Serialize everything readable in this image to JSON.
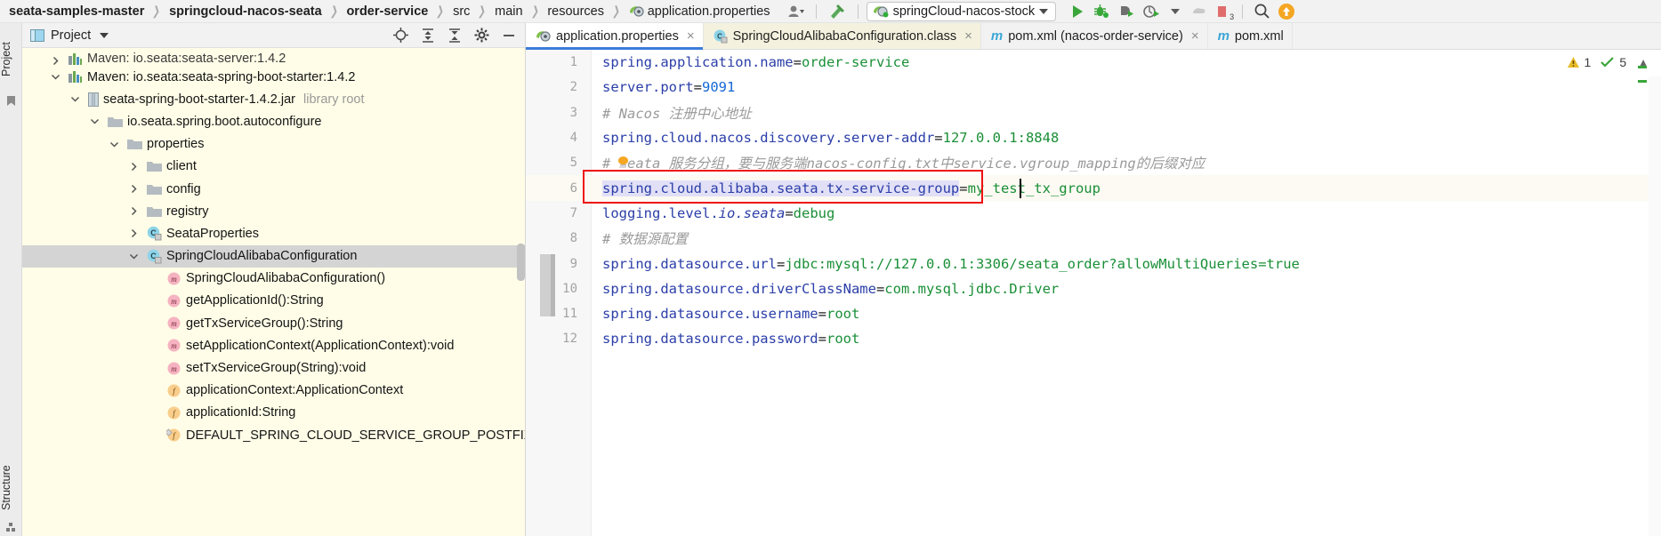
{
  "topbar": {
    "breadcrumbs": [
      {
        "label": "seata-samples-master",
        "bold": true,
        "icon": ""
      },
      {
        "label": "springcloud-nacos-seata",
        "bold": true,
        "icon": ""
      },
      {
        "label": "order-service",
        "bold": true,
        "icon": ""
      },
      {
        "label": "src",
        "bold": false,
        "icon": ""
      },
      {
        "label": "main",
        "bold": false,
        "icon": ""
      },
      {
        "label": "resources",
        "bold": false,
        "icon": ""
      },
      {
        "label": "application.properties",
        "bold": false,
        "icon": "spring-properties-icon"
      }
    ],
    "separator": "›",
    "user_icon": "user-avatar-icon",
    "hammer_icon": "build-hammer-icon",
    "run_config": {
      "label": "springCloud-nacos-stock",
      "icon": "spring-boot-run-icon",
      "caret": "chevron-down-icon"
    },
    "actions": [
      {
        "name": "run-button",
        "icon": "play-icon"
      },
      {
        "name": "debug-button",
        "icon": "bug-icon"
      },
      {
        "name": "run-with-coverage-button",
        "icon": "coverage-icon"
      },
      {
        "name": "profile-button",
        "icon": "profiler-icon"
      },
      {
        "name": "stop-button",
        "icon": "stop-icon"
      },
      {
        "name": "services-badge",
        "icon": "services-icon",
        "badge": "3"
      },
      {
        "name": "search-everywhere-button",
        "icon": "search-icon"
      },
      {
        "name": "updates-button",
        "icon": "update-arrow-icon"
      }
    ]
  },
  "left_strip": {
    "project_label": "Project",
    "structure_label": "Structure"
  },
  "project_panel": {
    "title": "Project",
    "title_icon": "project-window-icon",
    "caret_icon": "chevron-down-icon",
    "header_actions": [
      {
        "name": "locate-file-button",
        "icon": "crosshair-icon"
      },
      {
        "name": "expand-all-button",
        "icon": "expand-all-icon"
      },
      {
        "name": "collapse-all-button",
        "icon": "collapse-all-icon"
      },
      {
        "name": "settings-button",
        "icon": "gear-icon"
      },
      {
        "name": "hide-button",
        "icon": "minus-icon"
      }
    ],
    "tree": [
      {
        "indent": 1,
        "arrow": "›",
        "icon": "maven-icon",
        "label": "Maven: io.seata:seata-server:1.4.2",
        "dim": "",
        "selected": false,
        "clipped": true
      },
      {
        "indent": 1,
        "arrow": "∨",
        "icon": "maven-icon",
        "label": "Maven: io.seata:seata-spring-boot-starter:1.4.2",
        "dim": "",
        "selected": false
      },
      {
        "indent": 2,
        "arrow": "∨",
        "icon": "jar-icon",
        "label": "seata-spring-boot-starter-1.4.2.jar",
        "dim": "library root",
        "selected": false
      },
      {
        "indent": 3,
        "arrow": "∨",
        "icon": "folder-icon",
        "label": "io.seata.spring.boot.autoconfigure",
        "dim": "",
        "selected": false
      },
      {
        "indent": 4,
        "arrow": "∨",
        "icon": "folder-icon",
        "label": "properties",
        "dim": "",
        "selected": false
      },
      {
        "indent": 5,
        "arrow": "›",
        "icon": "folder-icon",
        "label": "client",
        "dim": "",
        "selected": false
      },
      {
        "indent": 5,
        "arrow": "›",
        "icon": "folder-icon",
        "label": "config",
        "dim": "",
        "selected": false
      },
      {
        "indent": 5,
        "arrow": "›",
        "icon": "folder-icon",
        "label": "registry",
        "dim": "",
        "selected": false
      },
      {
        "indent": 5,
        "arrow": "›",
        "icon": "class-icon",
        "label": "SeataProperties",
        "dim": "",
        "selected": false
      },
      {
        "indent": 5,
        "arrow": "∨",
        "icon": "class-icon",
        "label": "SpringCloudAlibabaConfiguration",
        "dim": "",
        "selected": true
      },
      {
        "indent": 6,
        "arrow": "",
        "icon": "method-icon",
        "label": "SpringCloudAlibabaConfiguration()",
        "dim": "",
        "selected": false
      },
      {
        "indent": 6,
        "arrow": "",
        "icon": "method-icon",
        "label": "getApplicationId():String",
        "dim": "",
        "selected": false
      },
      {
        "indent": 6,
        "arrow": "",
        "icon": "method-icon",
        "label": "getTxServiceGroup():String",
        "dim": "",
        "selected": false
      },
      {
        "indent": 6,
        "arrow": "",
        "icon": "method-icon",
        "label": "setApplicationContext(ApplicationContext):void",
        "dim": "",
        "selected": false
      },
      {
        "indent": 6,
        "arrow": "",
        "icon": "method-icon",
        "label": "setTxServiceGroup(String):void",
        "dim": "",
        "selected": false
      },
      {
        "indent": 6,
        "arrow": "",
        "icon": "field-icon",
        "label": "applicationContext:ApplicationContext",
        "dim": "",
        "selected": false
      },
      {
        "indent": 6,
        "arrow": "",
        "icon": "field-icon",
        "label": "applicationId:String",
        "dim": "",
        "selected": false
      },
      {
        "indent": 6,
        "arrow": "",
        "icon": "static-field-icon",
        "label": "DEFAULT_SPRING_CLOUD_SERVICE_GROUP_POSTFIX:S",
        "dim": "",
        "selected": false
      }
    ]
  },
  "editor": {
    "tabs": [
      {
        "label": "application.properties",
        "icon": "spring-properties-icon",
        "active": true,
        "close": "×"
      },
      {
        "label": "SpringCloudAlibabaConfiguration.class",
        "icon": "class-icon",
        "active": false,
        "close": "×"
      },
      {
        "label": "pom.xml (nacos-order-service)",
        "icon": "maven-m-icon",
        "active": false,
        "close": "×"
      },
      {
        "label": "pom.xml",
        "icon": "maven-m-icon",
        "active": false,
        "close": ""
      }
    ],
    "inspection": {
      "warning_count": "1",
      "warning_icon": "warning-triangle-icon",
      "ok_count": "5",
      "ok_icon": "inspection-check-icon",
      "collapse_icon": "chevron-up-icon"
    },
    "cursor_line": 6,
    "file_name": "application.properties",
    "lines": [
      {
        "num": "1",
        "segments": [
          {
            "t": "spring.application.name",
            "c": "k-key"
          },
          {
            "t": "=",
            "c": "k-eq"
          },
          {
            "t": "order-service",
            "c": "k-val"
          }
        ]
      },
      {
        "num": "2",
        "segments": [
          {
            "t": "server.port",
            "c": "k-key"
          },
          {
            "t": "=",
            "c": "k-eq"
          },
          {
            "t": "9091",
            "c": "k-num"
          }
        ]
      },
      {
        "num": "3",
        "segments": [
          {
            "t": "# Nacos 注册中心地址",
            "c": "k-cmt"
          }
        ]
      },
      {
        "num": "4",
        "segments": [
          {
            "t": "spring.cloud.nacos.discovery.server-addr",
            "c": "k-key"
          },
          {
            "t": "=",
            "c": "k-eq"
          },
          {
            "t": "127.0.0.1:8848",
            "c": "k-val"
          }
        ]
      },
      {
        "num": "5",
        "segments": [
          {
            "t": "# seata 服务分组，要与服务端nacos-config.txt中service.vgroup_mapping的后缀对应",
            "c": "k-cmt"
          }
        ]
      },
      {
        "num": "6",
        "segments": [
          {
            "t": "spring.cloud.alibaba.seata.tx-service-group",
            "c": "k-key"
          },
          {
            "t": "=",
            "c": "k-eq"
          },
          {
            "t": "my_test_tx_group",
            "c": "k-val"
          }
        ]
      },
      {
        "num": "7",
        "segments": [
          {
            "t": "logging.level.",
            "c": "k-key"
          },
          {
            "t": "io.seata",
            "c": "k-key k-ital"
          },
          {
            "t": "=",
            "c": "k-eq"
          },
          {
            "t": "debug",
            "c": "k-dbg"
          }
        ]
      },
      {
        "num": "8",
        "segments": [
          {
            "t": "# 数据源配置",
            "c": "k-cmt"
          }
        ]
      },
      {
        "num": "9",
        "segments": [
          {
            "t": "spring.datasource.url",
            "c": "k-key"
          },
          {
            "t": "=",
            "c": "k-eq"
          },
          {
            "t": "jdbc:mysql://127.0.0.1:3306/seata_order?allowMultiQueries=true",
            "c": "k-val"
          }
        ]
      },
      {
        "num": "10",
        "segments": [
          {
            "t": "spring.datasource.driverClassName",
            "c": "k-key"
          },
          {
            "t": "=",
            "c": "k-eq"
          },
          {
            "t": "com.mysql.jdbc.Driver",
            "c": "k-val"
          }
        ]
      },
      {
        "num": "11",
        "segments": [
          {
            "t": "spring.datasource.username",
            "c": "k-key"
          },
          {
            "t": "=",
            "c": "k-eq"
          },
          {
            "t": "root",
            "c": "k-val"
          }
        ]
      },
      {
        "num": "12",
        "segments": [
          {
            "t": "spring.datasource.password",
            "c": "k-key"
          },
          {
            "t": "=",
            "c": "k-eq"
          },
          {
            "t": "root",
            "c": "k-val"
          }
        ]
      }
    ],
    "annotation": {
      "type": "red-rectangle-highlight",
      "target_line": "6",
      "color": "#ee1111"
    }
  }
}
